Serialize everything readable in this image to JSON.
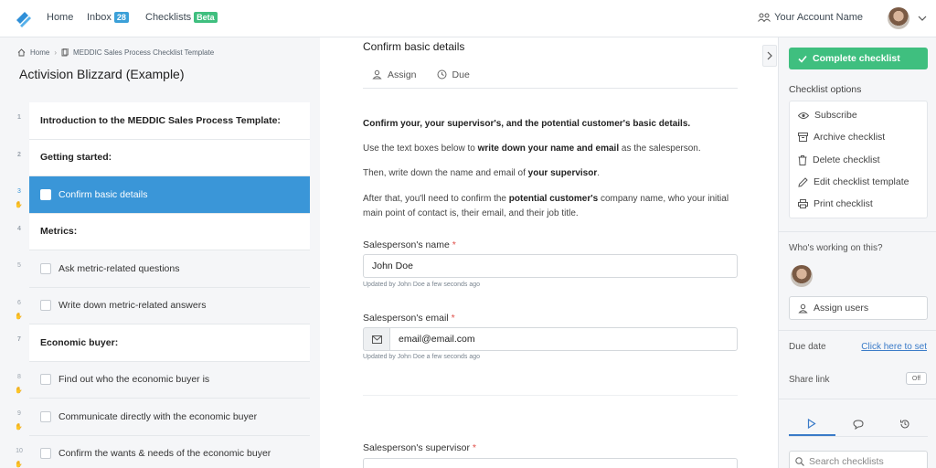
{
  "nav": {
    "home": "Home",
    "inbox": "Inbox",
    "inbox_count": "28",
    "checklists": "Checklists",
    "beta": "Beta",
    "account": "Your Account Name"
  },
  "breadcrumb": {
    "home": "Home",
    "template": "MEDDIC Sales Process Checklist Template"
  },
  "process_title": "Activision Blizzard (Example)",
  "tasks": [
    {
      "num": "1",
      "label": "Introduction to the MEDDIC Sales Process Template:",
      "type": "heading"
    },
    {
      "num": "2",
      "label": "Getting started:",
      "type": "heading"
    },
    {
      "num": "3",
      "label": "Confirm basic details",
      "type": "task",
      "active": true
    },
    {
      "num": "4",
      "label": "Metrics:",
      "type": "heading"
    },
    {
      "num": "5",
      "label": "Ask metric-related questions",
      "type": "task"
    },
    {
      "num": "6",
      "label": "Write down metric-related answers",
      "type": "task"
    },
    {
      "num": "7",
      "label": "Economic buyer:",
      "type": "heading"
    },
    {
      "num": "8",
      "label": "Find out who the economic buyer is",
      "type": "task"
    },
    {
      "num": "9",
      "label": "Communicate directly with the economic buyer",
      "type": "task"
    },
    {
      "num": "10",
      "label": "Confirm the wants & needs of the economic buyer",
      "type": "task"
    }
  ],
  "main": {
    "title": "Confirm basic details",
    "assign": "Assign",
    "due": "Due",
    "intro_bold": "Confirm your, your supervisor's, and the potential customer's basic details.",
    "p1_a": "Use the text boxes below to ",
    "p1_b": "write down your name and email",
    "p1_c": " as the salesperson.",
    "p2_a": "Then, write down the name and email of ",
    "p2_b": "your supervisor",
    "p2_c": ".",
    "p3_a": "After that, you'll need to confirm the ",
    "p3_b": "potential customer's",
    "p3_c": " company name, who your initial main point of contact is, their email, and their job title.",
    "name_label": "Salesperson's name",
    "name_value": "John Doe",
    "name_updated": "Updated by John Doe a few seconds ago",
    "email_label": "Salesperson's email",
    "email_value": "email@email.com",
    "email_updated": "Updated by John Doe a few seconds ago",
    "supervisor_label": "Salesperson's supervisor",
    "required": "*"
  },
  "right": {
    "complete": "Complete checklist",
    "options_heading": "Checklist options",
    "options": [
      "Subscribe",
      "Archive checklist",
      "Delete checklist",
      "Edit checklist template",
      "Print checklist"
    ],
    "working_heading": "Who's working on this?",
    "assign_users": "Assign users",
    "due_date": "Due date",
    "due_link": "Click here to set",
    "share_link": "Share link",
    "toggle": "Off",
    "search_placeholder": "Search checklists"
  },
  "colors": {
    "accent": "#3a96d8",
    "success": "#3fbf7f",
    "required": "#e0504a"
  }
}
